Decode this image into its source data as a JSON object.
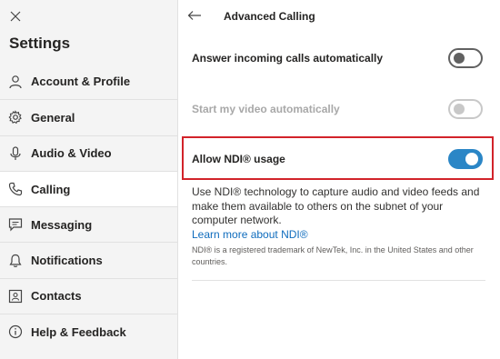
{
  "sidebar": {
    "title": "Settings",
    "items": [
      {
        "label": "Account & Profile",
        "icon": "person-icon"
      },
      {
        "label": "General",
        "icon": "gear-icon"
      },
      {
        "label": "Audio & Video",
        "icon": "microphone-icon"
      },
      {
        "label": "Calling",
        "icon": "phone-icon",
        "active": true
      },
      {
        "label": "Messaging",
        "icon": "chat-icon"
      },
      {
        "label": "Notifications",
        "icon": "bell-icon"
      },
      {
        "label": "Contacts",
        "icon": "contact-card-icon"
      },
      {
        "label": "Help & Feedback",
        "icon": "info-icon"
      }
    ]
  },
  "page": {
    "title": "Advanced Calling"
  },
  "settings": {
    "answer_incoming": {
      "label": "Answer incoming calls automatically",
      "state": "off"
    },
    "start_video": {
      "label": "Start my video automatically",
      "state": "off",
      "disabled": true
    },
    "allow_ndi": {
      "label": "Allow NDI® usage",
      "state": "on"
    }
  },
  "ndi": {
    "description": "Use NDI® technology to capture audio and video feeds and make them available to others on the subnet of your computer network.",
    "link": "Learn more about NDI®",
    "trademark": "NDI® is a registered trademark of NewTek, Inc. in the United States and other countries."
  },
  "colors": {
    "accent": "#2b86c6",
    "highlight_border": "#d2232a",
    "link": "#0f6cbd"
  }
}
